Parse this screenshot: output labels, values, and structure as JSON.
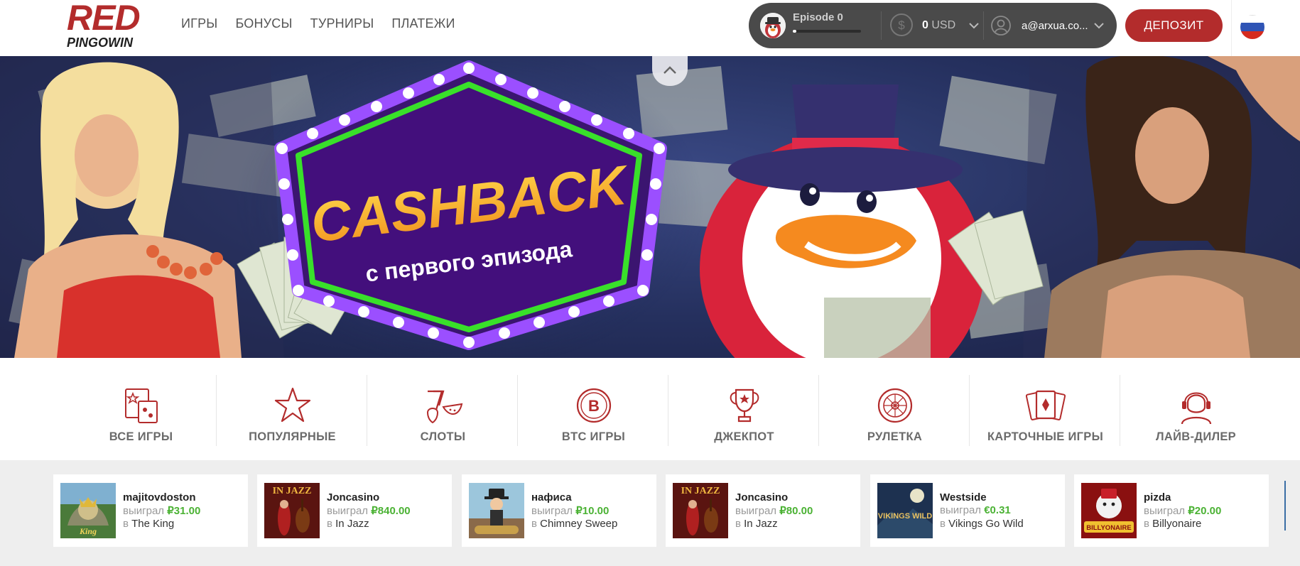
{
  "header": {
    "logo_top": "RED",
    "logo_bottom": "PINGOWIN",
    "nav": [
      "ИГРЫ",
      "БОНУСЫ",
      "ТУРНИРЫ",
      "ПЛАТЕЖИ"
    ],
    "episode_label": "Episode 0",
    "episode_progress": 0.05,
    "balance_amount": "0",
    "balance_currency": "USD",
    "email": "a@arxua.co...",
    "deposit_label": "ДЕПОЗИТ",
    "language": "Русский"
  },
  "banner": {
    "headline": "CASHBACK",
    "subline": "с первого эпизода"
  },
  "categories": [
    {
      "label": "ВСЕ ИГРЫ",
      "icon": "all-games-icon"
    },
    {
      "label": "ПОПУЛЯРНЫЕ",
      "icon": "star-icon"
    },
    {
      "label": "СЛОТЫ",
      "icon": "slots-icon"
    },
    {
      "label": "BTC ИГРЫ",
      "icon": "bitcoin-icon"
    },
    {
      "label": "ДЖЕКПОТ",
      "icon": "trophy-icon"
    },
    {
      "label": "РУЛЕТКА",
      "icon": "roulette-icon"
    },
    {
      "label": "КАРТОЧНЫЕ ИГРЫ",
      "icon": "cards-icon"
    },
    {
      "label": "ЛАЙВ-ДИЛЕР",
      "icon": "live-dealer-icon"
    }
  ],
  "winners": [
    {
      "name": "majitovdoston",
      "won_prefix": "выиграл",
      "amount": "₽31.00",
      "in_prefix": "в",
      "game": "The King"
    },
    {
      "name": "Joncasino",
      "won_prefix": "выиграл",
      "amount": "₽840.00",
      "in_prefix": "в",
      "game": "In Jazz"
    },
    {
      "name": "нафиса",
      "won_prefix": "выиграл",
      "amount": "₽10.00",
      "in_prefix": "в",
      "game": "Chimney Sweep"
    },
    {
      "name": "Joncasino",
      "won_prefix": "выиграл",
      "amount": "₽80.00",
      "in_prefix": "в",
      "game": "In Jazz"
    },
    {
      "name": "Westside",
      "won_prefix": "выиграл",
      "amount": "€0.31",
      "in_prefix": "в",
      "game": "Vikings Go Wild"
    },
    {
      "name": "pizda",
      "won_prefix": "выиграл",
      "amount": "₽20.00",
      "in_prefix": "в",
      "game": "Billyonaire"
    }
  ],
  "thumb_texts": {
    "the_king": "King",
    "in_jazz": "IN JAZZ",
    "vikings": "VIKINGS WILD",
    "billyonaire": "BILLYONAIRE"
  },
  "colors": {
    "brand_red": "#b32c2c",
    "win_green": "#4bb234",
    "panel_dark": "#4a4a4a"
  }
}
